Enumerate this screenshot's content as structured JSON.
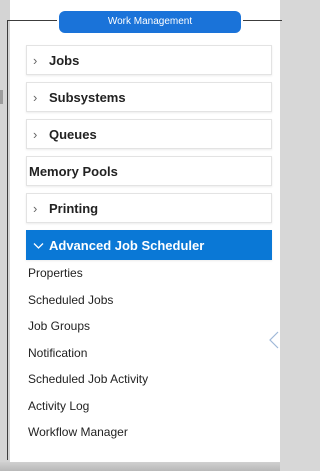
{
  "panel": {
    "title": "Work Management"
  },
  "menu": {
    "items": [
      {
        "label": "Jobs",
        "expandable": true
      },
      {
        "label": "Subsystems",
        "expandable": true
      },
      {
        "label": "Queues",
        "expandable": true
      },
      {
        "label": "Memory Pools",
        "expandable": false
      },
      {
        "label": "Printing",
        "expandable": true
      },
      {
        "label": "Advanced Job Scheduler",
        "expandable": true,
        "expanded": true
      }
    ],
    "subitems": [
      "Properties",
      "Scheduled Jobs",
      "Job Groups",
      "Notification",
      "Scheduled Job Activity",
      "Activity Log",
      "Workflow Manager"
    ]
  },
  "colors": {
    "accent": "#0a78d6",
    "title_bg": "#1a73d9"
  },
  "icons": {
    "collapsed": "chevron-right-icon",
    "expanded": "chevron-down-icon",
    "scroll": "chevron-left-icon"
  }
}
